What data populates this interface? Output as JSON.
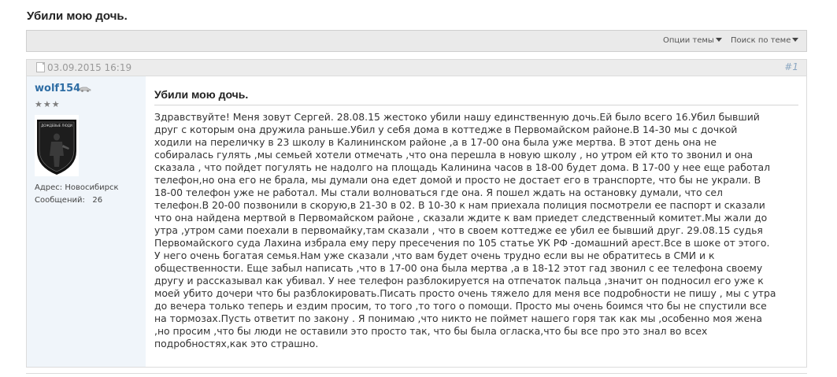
{
  "thread": {
    "title": "Убили мою дочь."
  },
  "toolbar": {
    "options_label": "Опции темы",
    "search_label": "Поиск по теме"
  },
  "post": {
    "date": "03.09.2015 16:19",
    "number": "#1",
    "title": "Убили мою дочь.",
    "lines": [
      "Здравствуйте! Меня зовут Сергей. 28.08.15 жестоко убили нашу единственную дочь.Ей было всего 16.Убил бывший",
      "друг с которым она дружила раньше.Убил у себя дома в коттедже в Первомайском районе.В 14-30 мы с дочкой",
      "ходили на переличку в 23 школу в Калининском районе ,а в 17-00 она была уже мертва. В этот день она не",
      "собиралась гулять ,мы семьей хотели отмечать ,что она перешла в новую школу , но утром ей кто то звонил и она",
      "сказала , что пойдет погулять не надолго на площадь Калинина часов в 18-00 будет дома. В 17-00 у нее еще работал",
      "телефон,но она его не брала, мы думали она едет домой и просто не достает его в транспорте, что бы не украли. В",
      "18-00 телефон уже не работал. Мы стали волноваться где она. Я пошел ждать на остановку думали, что сел",
      "телефон.В 20-00 позвонили в скорую,в 21-30 в 02. В 10-30 к нам приехала полиция посмотрели ее паспорт и сказали",
      "что она найдена мертвой в Первомайском районе , сказали ждите к вам приедет следственный комитет.Мы жали до",
      "утра ,утром сами поехали в первомайку,там сказали , что в своем коттедже ее убил ее бывший друг. 29.08.15 судья",
      "Первомайского суда Лахина избрала ему перу пресечения по 105 статье УК РФ -домашний арест.Все в шоке от этого.",
      "У него очень богатая семья.Нам уже сказали ,что вам будет очень трудно если вы не обратитесь в СМИ и к",
      "общественности. Еще забыл написать ,что в 17-00 она была мертва ,а в 18-12 этот гад звонил с ее телефона своему",
      "другу и рассказывал как убивал. У нее телефон разблокируется на отпечаток пальца ,значит он подносил его уже к",
      "моей убито дочери что бы разблокировать.Писать просто очень тяжело для меня все подробности не пишу , мы с утра",
      "до вечера только теперь и ездим просим, то того ,то того о помощи. Просто мы очень боимся что бы не спустили все",
      "на тормозах.Пусть ответит по закону . Я понимаю ,что никто не поймет нашего горя так как мы ,особенно моя жена",
      ",но просим ,что бы люди не оставили это просто так, что бы была огласка,что бы все про это знал во всех",
      "подробностях,как это страшно."
    ]
  },
  "user": {
    "name": "wolf154",
    "rank_stars": "★★★",
    "avatar_text": "ДОЖДЕВЫЕ ЛЮДИ",
    "address_label": "Адрес:",
    "address_value": "Новосибирск",
    "messages_label": "Сообщений:",
    "messages_value": "26"
  },
  "icons": {
    "doc": "document-icon",
    "car": "car-icon",
    "caret": "caret-down-icon"
  },
  "colors": {
    "username": "#2e6da4",
    "sidebar_bg": "#f0f5fa",
    "toolbar_bg": "#eaeaea"
  }
}
